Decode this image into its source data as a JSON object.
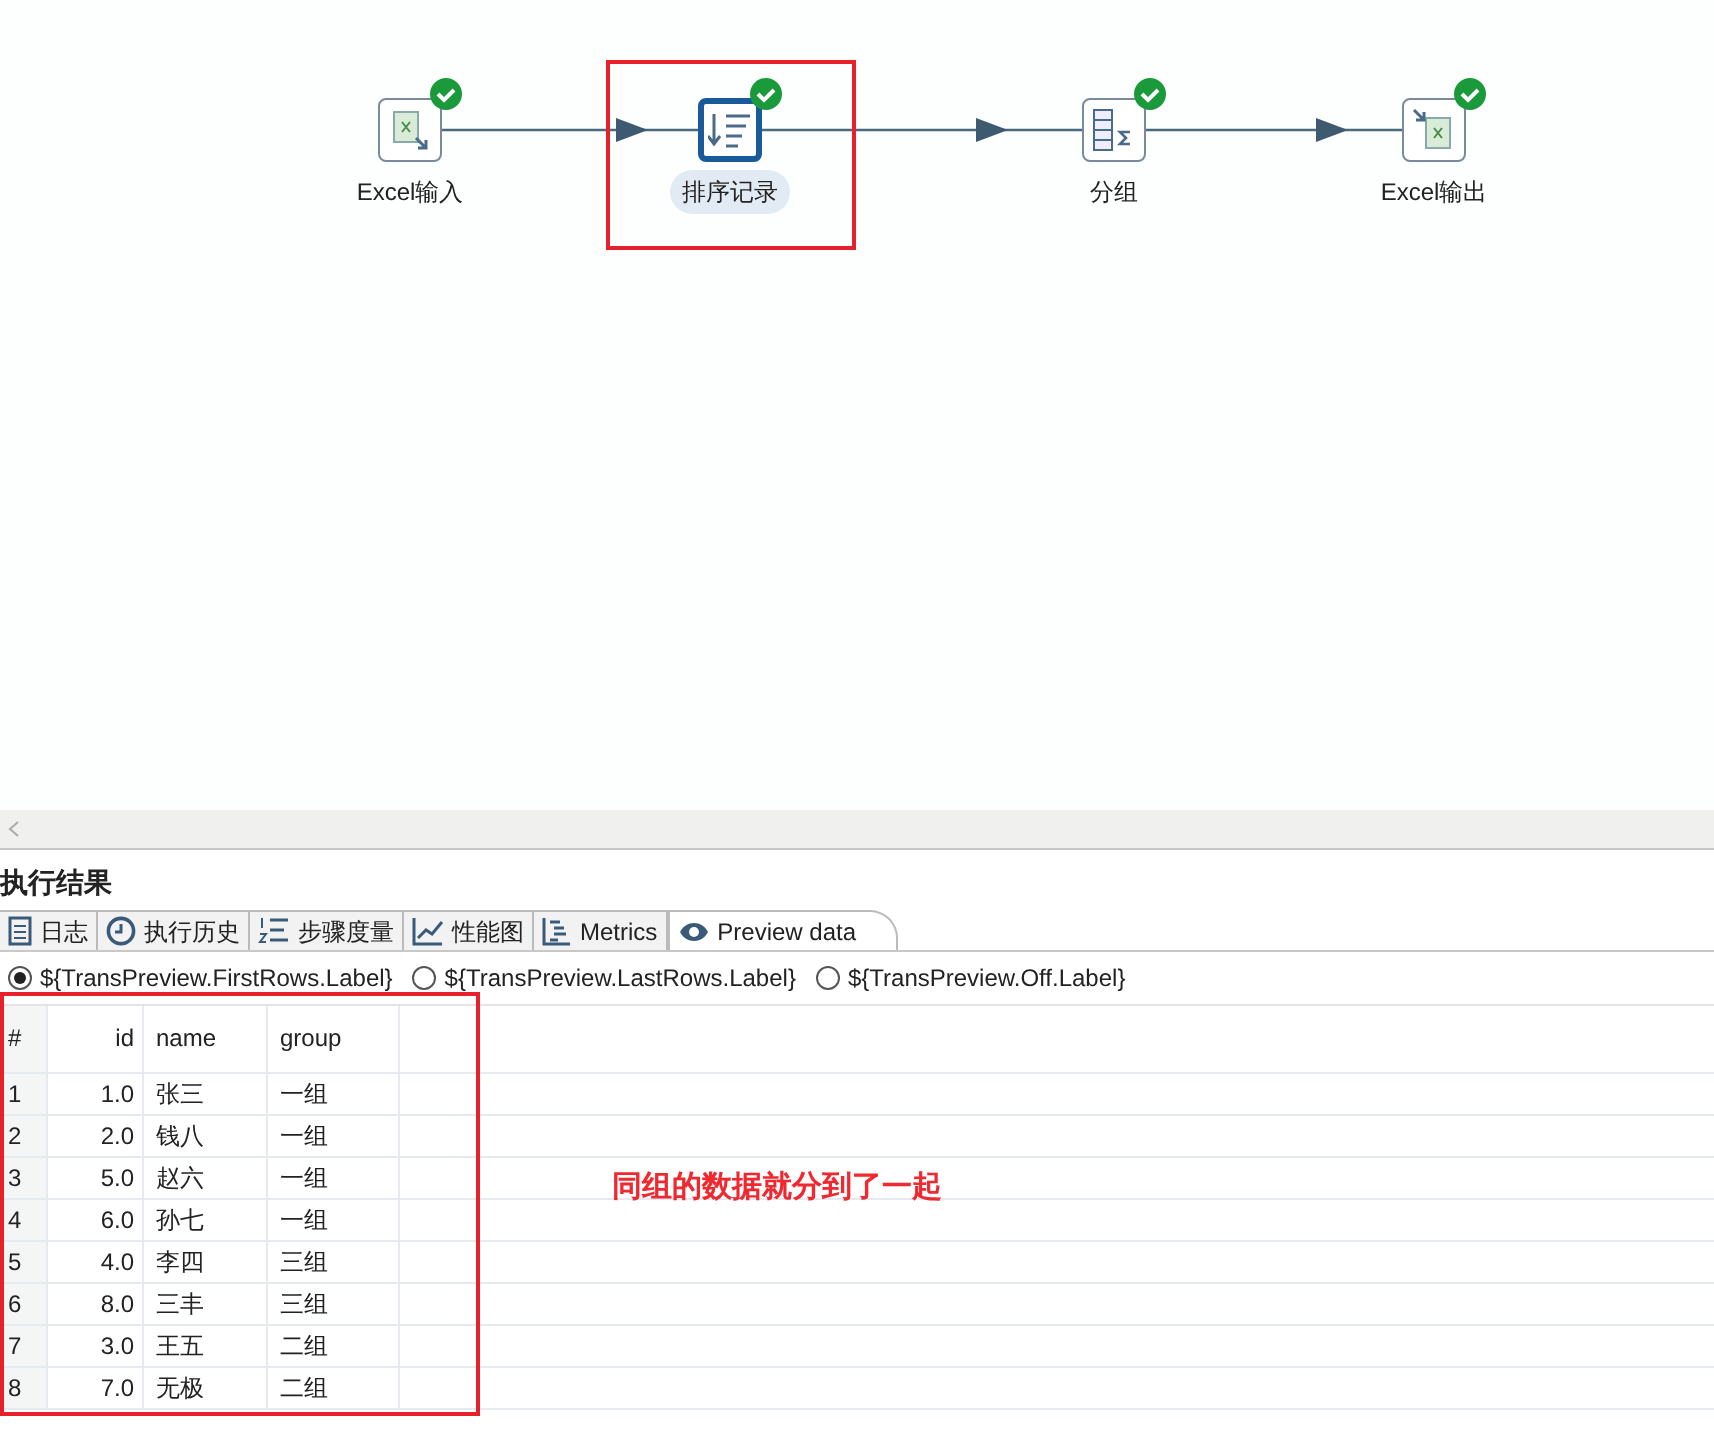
{
  "canvas": {
    "steps": [
      {
        "kind": "excel-in",
        "label": "Excel输入",
        "selected": false,
        "done": true
      },
      {
        "kind": "sort",
        "label": "排序记录",
        "selected": true,
        "done": true
      },
      {
        "kind": "group",
        "label": "分组",
        "selected": false,
        "done": true
      },
      {
        "kind": "excel-out",
        "label": "Excel输出",
        "selected": false,
        "done": true
      }
    ]
  },
  "results": {
    "title": "执行结果",
    "tabs": [
      {
        "kind": "log",
        "label": "日志",
        "selected": false
      },
      {
        "kind": "history",
        "label": "执行历史",
        "selected": false
      },
      {
        "kind": "metrics-list",
        "label": "步骤度量",
        "selected": false
      },
      {
        "kind": "chart",
        "label": "性能图",
        "selected": false
      },
      {
        "kind": "gantt",
        "label": "Metrics",
        "selected": false
      },
      {
        "kind": "eye",
        "label": "Preview data",
        "selected": true
      }
    ],
    "options": [
      {
        "label": "${TransPreview.FirstRows.Label}",
        "selected": true
      },
      {
        "label": "${TransPreview.LastRows.Label}",
        "selected": false
      },
      {
        "label": "${TransPreview.Off.Label}",
        "selected": false
      }
    ],
    "table": {
      "columns": [
        "#",
        "id",
        "name",
        "group"
      ],
      "rows": [
        [
          "1",
          "1.0",
          "张三",
          "一组"
        ],
        [
          "2",
          "2.0",
          "钱八",
          "一组"
        ],
        [
          "3",
          "5.0",
          "赵六",
          "一组"
        ],
        [
          "4",
          "6.0",
          "孙七",
          "一组"
        ],
        [
          "5",
          "4.0",
          "李四",
          "三组"
        ],
        [
          "6",
          "8.0",
          "三丰",
          "三组"
        ],
        [
          "7",
          "3.0",
          "王五",
          "二组"
        ],
        [
          "8",
          "7.0",
          "无极",
          "二组"
        ]
      ]
    }
  },
  "annotation": {
    "text": "同组的数据就分到了一起"
  }
}
